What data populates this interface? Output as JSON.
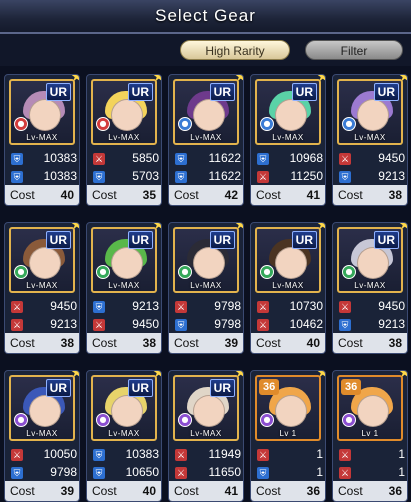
{
  "title": "Select Gear",
  "buttons": {
    "high_rarity": "High Rarity",
    "filter": "Filter"
  },
  "cost_label": "Cost",
  "cards": [
    {
      "badge": "UR",
      "level": "Lv-MAX",
      "hair": "#b68bb6",
      "frame": "#e2b34d",
      "attr_color": "#d33c3c",
      "stat1_type": "def",
      "stat1": "10383",
      "stat2_type": "def",
      "stat2": "10383",
      "cost": "40"
    },
    {
      "badge": "UR",
      "level": "Lv-MAX",
      "hair": "#f3d35b",
      "frame": "#e2b34d",
      "attr_color": "#d33c3c",
      "stat1_type": "atk",
      "stat1": "5850",
      "stat2_type": "def",
      "stat2": "5703",
      "cost": "35"
    },
    {
      "badge": "UR",
      "level": "Lv-MAX",
      "hair": "#6e3a8c",
      "frame": "#e2b34d",
      "attr_color": "#3a7bd5",
      "stat1_type": "def",
      "stat1": "11622",
      "stat2_type": "def",
      "stat2": "11622",
      "cost": "42"
    },
    {
      "badge": "UR",
      "level": "Lv-MAX",
      "hair": "#5ad2a7",
      "frame": "#e2b34d",
      "attr_color": "#3a7bd5",
      "stat1_type": "def",
      "stat1": "10968",
      "stat2_type": "atk",
      "stat2": "11250",
      "cost": "41"
    },
    {
      "badge": "UR",
      "level": "Lv-MAX",
      "hair": "#9c7ad1",
      "frame": "#e2b34d",
      "attr_color": "#3a7bd5",
      "stat1_type": "atk",
      "stat1": "9450",
      "stat2_type": "def",
      "stat2": "9213",
      "cost": "38"
    },
    {
      "badge": "UR",
      "level": "Lv-MAX",
      "hair": "#8a5a3a",
      "frame": "#e2b34d",
      "attr_color": "#35a85a",
      "stat1_type": "atk",
      "stat1": "9450",
      "stat2_type": "atk",
      "stat2": "9213",
      "cost": "38"
    },
    {
      "badge": "UR",
      "level": "Lv-MAX",
      "hair": "#59b84a",
      "frame": "#e2b34d",
      "attr_color": "#35a85a",
      "stat1_type": "def",
      "stat1": "9213",
      "stat2_type": "atk",
      "stat2": "9450",
      "cost": "38"
    },
    {
      "badge": "UR",
      "level": "Lv-MAX",
      "hair": "#2b2b36",
      "frame": "#e2b34d",
      "attr_color": "#35a85a",
      "stat1_type": "atk",
      "stat1": "9798",
      "stat2_type": "def",
      "stat2": "9798",
      "cost": "39"
    },
    {
      "badge": "UR",
      "level": "Lv-MAX",
      "hair": "#4b3422",
      "frame": "#e2b34d",
      "attr_color": "#35a85a",
      "stat1_type": "atk",
      "stat1": "10730",
      "stat2_type": "atk",
      "stat2": "10462",
      "cost": "40"
    },
    {
      "badge": "UR",
      "level": "Lv-MAX",
      "hair": "#c7c7d6",
      "frame": "#e2b34d",
      "attr_color": "#35a85a",
      "stat1_type": "atk",
      "stat1": "9450",
      "stat2_type": "def",
      "stat2": "9213",
      "cost": "38"
    },
    {
      "badge": "UR",
      "level": "Lv-MAX",
      "hair": "#3b58b8",
      "frame": "#e2b34d",
      "attr_color": "#8b4fd1",
      "stat1_type": "atk",
      "stat1": "10050",
      "stat2_type": "def",
      "stat2": "9798",
      "cost": "39"
    },
    {
      "badge": "UR",
      "level": "Lv-MAX",
      "hair": "#e7d36a",
      "frame": "#e2b34d",
      "attr_color": "#8b4fd1",
      "stat1_type": "def",
      "stat1": "10383",
      "stat2_type": "def",
      "stat2": "10650",
      "cost": "40"
    },
    {
      "badge": "UR",
      "level": "Lv-MAX",
      "hair": "#e0d6c8",
      "frame": "#e2b34d",
      "attr_color": "#8b4fd1",
      "stat1_type": "atk",
      "stat1": "11949",
      "stat2_type": "atk",
      "stat2": "11650",
      "cost": "41"
    },
    {
      "badge": "36",
      "level": "Lv 1",
      "hair": "#f0a64a",
      "frame": "#e08b2b",
      "attr_color": "#8b4fd1",
      "stat1_type": "atk",
      "stat1": "1",
      "stat2_type": "def",
      "stat2": "1",
      "cost": "36"
    },
    {
      "badge": "36",
      "level": "Lv 1",
      "hair": "#f0a64a",
      "frame": "#e08b2b",
      "attr_color": "#8b4fd1",
      "stat1_type": "atk",
      "stat1": "1",
      "stat2_type": "atk",
      "stat2": "1",
      "cost": "36"
    }
  ]
}
